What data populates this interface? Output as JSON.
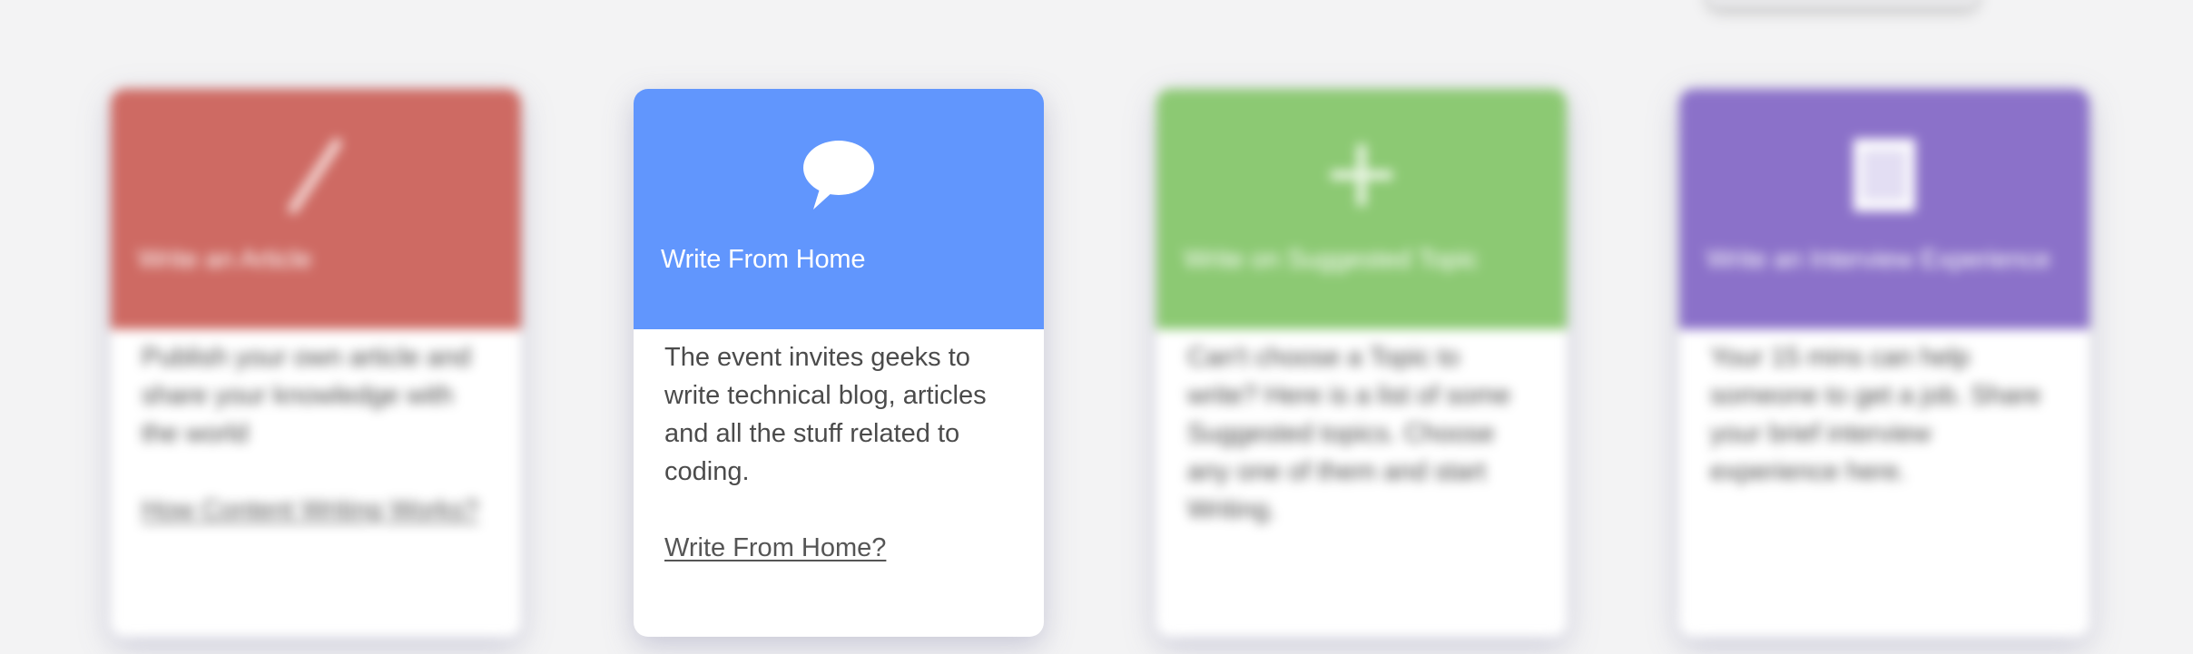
{
  "cards": [
    {
      "title": "Write an Article",
      "text": "Publish your own article and share your knowledge with the world",
      "link": "How Content Writing Works?",
      "color": "#ce6a63",
      "icon": "pencil-icon"
    },
    {
      "title": "Write From Home",
      "text": "The event invites geeks to write technical blog, articles and all the stuff related to coding.",
      "link": "Write From Home?",
      "color": "#6196fd",
      "icon": "speech-bubble-icon"
    },
    {
      "title": "Write on Suggested Topic",
      "text": "Can't choose a Topic to write? Here is a list of some Suggested topics. Choose any one of them and start Writing.",
      "link": "",
      "color": "#8cc973",
      "icon": "plus-icon"
    },
    {
      "title": "Write an Interview Experience",
      "text": "Your 15 mins can help someone to get a job. Share your brief interview experience here.",
      "link": "",
      "color": "#8b71c9",
      "icon": "document-icon"
    }
  ]
}
